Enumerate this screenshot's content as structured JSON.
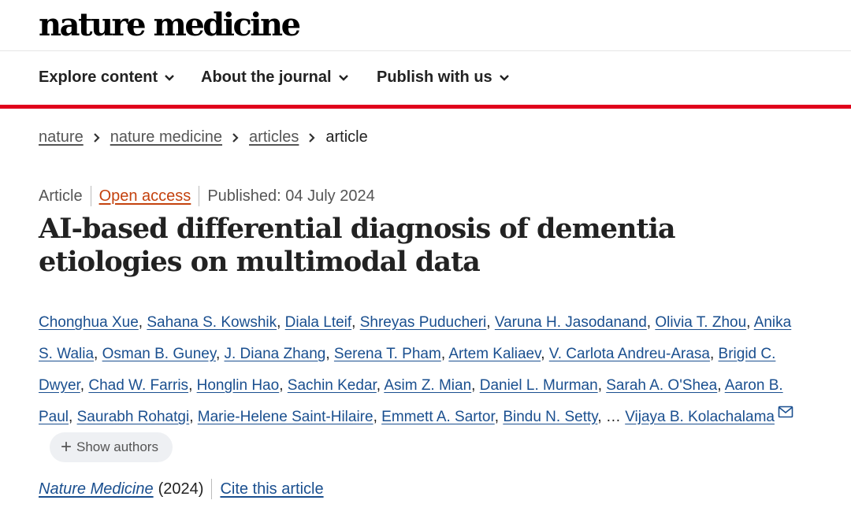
{
  "site": {
    "logo": "nature medicine"
  },
  "nav": [
    {
      "label": "Explore content"
    },
    {
      "label": "About the journal"
    },
    {
      "label": "Publish with us"
    }
  ],
  "breadcrumb": [
    "nature",
    "nature medicine",
    "articles",
    "article"
  ],
  "article": {
    "type": "Article",
    "access": "Open access",
    "published": "Published: 04 July 2024",
    "title": "AI-based differential diagnosis of dementia etiologies on multimodal data",
    "authors": [
      "Chonghua Xue",
      "Sahana S. Kowshik",
      "Diala Lteif",
      "Shreyas Puducheri",
      "Varuna H. Jasodanand",
      "Olivia T. Zhou",
      "Anika S. Walia",
      "Osman B. Guney",
      "J. Diana Zhang",
      "Serena T. Pham",
      "Artem Kaliaev",
      "V. Carlota Andreu-Arasa",
      "Brigid C. Dwyer",
      "Chad W. Farris",
      "Honglin Hao",
      "Sachin Kedar",
      "Asim Z. Mian",
      "Daniel L. Murman",
      "Sarah A. O'Shea",
      "Aaron B. Paul",
      "Saurabh Rohatgi",
      "Marie-Helene Saint-Hilaire",
      "Emmett A. Sartor",
      "Bindu N. Setty"
    ],
    "ellipsis": "…",
    "corresponding_author": "Vijaya B. Kolachalama",
    "show_authors": "Show authors",
    "journal": "Nature Medicine",
    "year": "(2024)",
    "cite": "Cite this article"
  },
  "icons": {
    "nav_chevron": "chevron-down-icon",
    "crumb_sep": "chevron-right-icon",
    "email": "mail-icon",
    "plus": "plus-icon"
  },
  "colors": {
    "accent_red": "#e0001b",
    "link_blue": "#1a4f8f",
    "open_access": "#c4420e"
  }
}
